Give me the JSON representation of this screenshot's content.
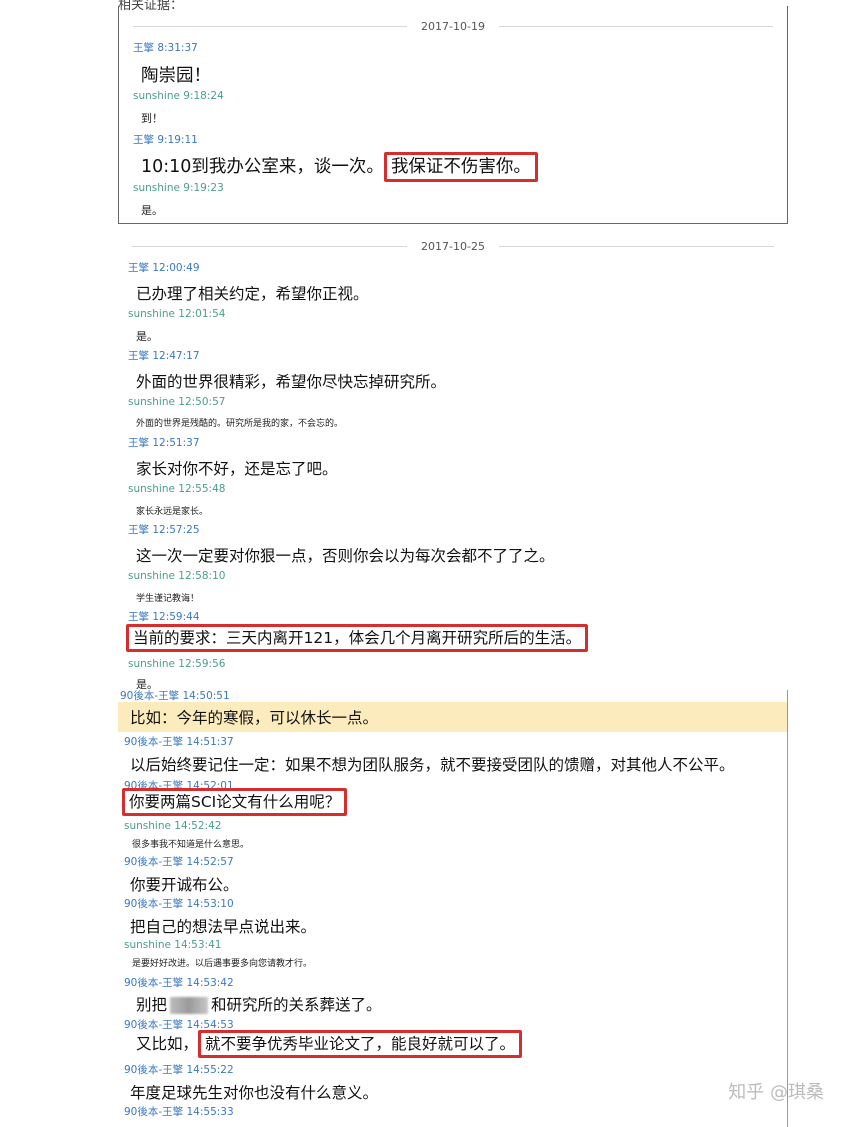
{
  "top_cut_text": "相关证据：",
  "panel1": {
    "date": "2017-10-19",
    "messages": [
      {
        "sender": "王擎 8:31:37",
        "text": "陶崇园！"
      },
      {
        "sender": "sunshine 9:18:24",
        "text": "到！"
      },
      {
        "sender": "王擎 9:19:11",
        "text": "10:10到我办公室来，谈一次。",
        "boxed": "我保证不伤害你。"
      },
      {
        "sender": "sunshine 9:19:23",
        "text": "是。"
      }
    ]
  },
  "panel2": {
    "date": "2017-10-25",
    "messages": [
      {
        "sender": "王擎 12:00:49",
        "text": "已办理了相关约定，希望你正视。"
      },
      {
        "sender": "sunshine 12:01:54",
        "text": "是。"
      },
      {
        "sender": "王擎 12:47:17",
        "text": "外面的世界很精彩，希望你尽快忘掉研究所。"
      },
      {
        "sender": "sunshine 12:50:57",
        "text": "外面的世界是残酷的。研究所是我的家，不会忘的。"
      },
      {
        "sender": "王擎 12:51:37",
        "text": "家长对你不好，还是忘了吧。"
      },
      {
        "sender": "sunshine 12:55:48",
        "text": "家长永远是家长。"
      },
      {
        "sender": "王擎 12:57:25",
        "text": "这一次一定要对你狠一点，否则你会以为每次会都不了了之。"
      },
      {
        "sender": "sunshine 12:58:10",
        "text": "学生谨记教诲！"
      },
      {
        "sender": "王擎 12:59:44",
        "text": "当前的要求：三天内离开121，体会几个月离开研究所后的生活。"
      },
      {
        "sender": "sunshine 12:59:56",
        "text": "是。"
      }
    ]
  },
  "panel3": {
    "messages": [
      {
        "sender": "90後本-王擎 14:50:51",
        "text": "比如：今年的寒假，可以休长一点。"
      },
      {
        "sender": "90後本-王擎 14:51:37",
        "text": "以后始终要记住一定：如果不想为团队服务，就不要接受团队的馈赠，对其他人不公平。"
      },
      {
        "sender": "90後本-王擎 14:52:01",
        "text": "你要两篇SCI论文有什么用呢？"
      },
      {
        "sender": "sunshine 14:52:42",
        "text": "很多事我不知道是什么意思。"
      },
      {
        "sender": "90後本-王擎 14:52:57",
        "text": "你要开诚布公。"
      },
      {
        "sender": "90後本-王擎 14:53:10",
        "text": "把自己的想法早点说出来。"
      },
      {
        "sender": "sunshine 14:53:41",
        "text": "是要好好改进。以后遇事要多向您请教才行。"
      },
      {
        "sender": "90後本-王擎 14:53:42",
        "text_before": "别把",
        "text_after": "和研究所的关系葬送了。"
      },
      {
        "sender": "90後本-王擎 14:54:53",
        "text": "又比如，",
        "boxed": "就不要争优秀毕业论文了，能良好就可以了。"
      },
      {
        "sender": "90後本-王擎 14:55:22",
        "text": "年度足球先生对你也没有什么意义。"
      },
      {
        "sender": "90後本-王擎 14:55:33"
      }
    ]
  },
  "watermark": "知乎 @琪桑",
  "colors": {
    "sender_blue": "#3b78c4",
    "sender_green": "#4c9e8c",
    "box_red": "#d42e2e",
    "highlight": "#fbebbd"
  }
}
